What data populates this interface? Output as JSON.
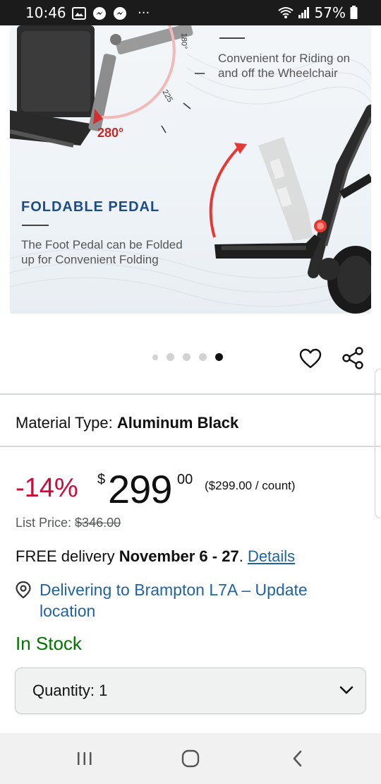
{
  "status_bar": {
    "time": "10:46",
    "overflow": "···",
    "battery": "57%",
    "icons": [
      "gallery-icon",
      "messenger-icon",
      "messenger-icon",
      "wifi-icon",
      "signal-icon",
      "battery-icon"
    ]
  },
  "hero": {
    "top_desc_line1": "Convenient for Riding on",
    "top_desc_line2": "and off the Wheelchair",
    "angle_label": "280°",
    "dial_label_1": "180°",
    "dial_label_2": "225",
    "heading": "FOLDABLE PEDAL",
    "desc_line1": "The Foot Pedal can be Folded",
    "desc_line2": "up for Convenient Folding"
  },
  "carousel": {
    "count": 5,
    "active_index": 4
  },
  "material": {
    "label": "Material Type:",
    "value": "Aluminum Black"
  },
  "price": {
    "discount": "-14%",
    "currency": "$",
    "whole": "299",
    "fraction": "00",
    "unit_price": "($299.00 / count)"
  },
  "list_price": {
    "label": "List Price:",
    "value": "$346.00"
  },
  "delivery": {
    "prefix": "FREE delivery",
    "dates": "November 6 - 27",
    "suffix": ".",
    "link": "Details"
  },
  "location": {
    "text": "Delivering to Brampton L7A – Update location"
  },
  "stock": "In Stock",
  "quantity": {
    "label": "Quantity:",
    "value": "1"
  },
  "colors": {
    "price_red": "#cc0c39",
    "link_blue": "#2162a1",
    "stock_green": "#007600",
    "heading_blue": "#1d4d86"
  }
}
